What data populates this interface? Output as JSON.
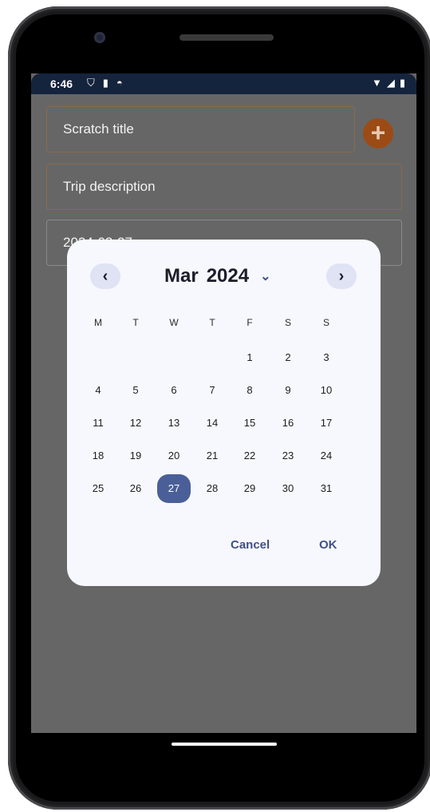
{
  "status_bar": {
    "time": "6:46",
    "left_icons": [
      "shield-icon",
      "sd-card-icon",
      "app-icon"
    ],
    "right_icons": [
      "wifi-icon",
      "signal-icon",
      "battery-icon"
    ]
  },
  "form": {
    "title_placeholder": "Scratch title",
    "description_placeholder": "Trip description",
    "date_value": "2024-03-27",
    "add_button": "+"
  },
  "date_picker": {
    "month": "Mar",
    "year": "2024",
    "prev_glyph": "‹",
    "next_glyph": "›",
    "dropdown_glyph": "⌄",
    "weekdays": [
      "M",
      "T",
      "W",
      "T",
      "F",
      "S",
      "S"
    ],
    "first_weekday_index": 4,
    "days_in_month": 31,
    "selected_day": 27,
    "cancel_label": "Cancel",
    "ok_label": "OK"
  },
  "colors": {
    "scrim": "#666666",
    "dialog_bg": "#f7f8fd",
    "accent": "#3f5187",
    "selected_bg": "#4a5f98",
    "add_button": "#9c4b15"
  }
}
